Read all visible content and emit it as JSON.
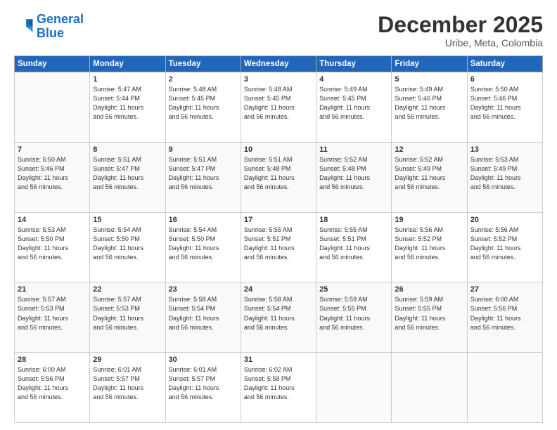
{
  "logo": {
    "line1": "General",
    "line2": "Blue"
  },
  "title": "December 2025",
  "subtitle": "Uribe, Meta, Colombia",
  "header_days": [
    "Sunday",
    "Monday",
    "Tuesday",
    "Wednesday",
    "Thursday",
    "Friday",
    "Saturday"
  ],
  "weeks": [
    [
      {
        "num": "",
        "info": ""
      },
      {
        "num": "1",
        "info": "Sunrise: 5:47 AM\nSunset: 5:44 PM\nDaylight: 11 hours\nand 56 minutes."
      },
      {
        "num": "2",
        "info": "Sunrise: 5:48 AM\nSunset: 5:45 PM\nDaylight: 11 hours\nand 56 minutes."
      },
      {
        "num": "3",
        "info": "Sunrise: 5:48 AM\nSunset: 5:45 PM\nDaylight: 11 hours\nand 56 minutes."
      },
      {
        "num": "4",
        "info": "Sunrise: 5:49 AM\nSunset: 5:45 PM\nDaylight: 11 hours\nand 56 minutes."
      },
      {
        "num": "5",
        "info": "Sunrise: 5:49 AM\nSunset: 5:46 PM\nDaylight: 11 hours\nand 56 minutes."
      },
      {
        "num": "6",
        "info": "Sunrise: 5:50 AM\nSunset: 5:46 PM\nDaylight: 11 hours\nand 56 minutes."
      }
    ],
    [
      {
        "num": "7",
        "info": "Sunrise: 5:50 AM\nSunset: 5:46 PM\nDaylight: 11 hours\nand 56 minutes."
      },
      {
        "num": "8",
        "info": "Sunrise: 5:51 AM\nSunset: 5:47 PM\nDaylight: 11 hours\nand 56 minutes."
      },
      {
        "num": "9",
        "info": "Sunrise: 5:51 AM\nSunset: 5:47 PM\nDaylight: 11 hours\nand 56 minutes."
      },
      {
        "num": "10",
        "info": "Sunrise: 5:51 AM\nSunset: 5:48 PM\nDaylight: 11 hours\nand 56 minutes."
      },
      {
        "num": "11",
        "info": "Sunrise: 5:52 AM\nSunset: 5:48 PM\nDaylight: 11 hours\nand 56 minutes."
      },
      {
        "num": "12",
        "info": "Sunrise: 5:52 AM\nSunset: 5:49 PM\nDaylight: 11 hours\nand 56 minutes."
      },
      {
        "num": "13",
        "info": "Sunrise: 5:53 AM\nSunset: 5:49 PM\nDaylight: 11 hours\nand 56 minutes."
      }
    ],
    [
      {
        "num": "14",
        "info": "Sunrise: 5:53 AM\nSunset: 5:50 PM\nDaylight: 11 hours\nand 56 minutes."
      },
      {
        "num": "15",
        "info": "Sunrise: 5:54 AM\nSunset: 5:50 PM\nDaylight: 11 hours\nand 56 minutes."
      },
      {
        "num": "16",
        "info": "Sunrise: 5:54 AM\nSunset: 5:50 PM\nDaylight: 11 hours\nand 56 minutes."
      },
      {
        "num": "17",
        "info": "Sunrise: 5:55 AM\nSunset: 5:51 PM\nDaylight: 11 hours\nand 56 minutes."
      },
      {
        "num": "18",
        "info": "Sunrise: 5:55 AM\nSunset: 5:51 PM\nDaylight: 11 hours\nand 56 minutes."
      },
      {
        "num": "19",
        "info": "Sunrise: 5:56 AM\nSunset: 5:52 PM\nDaylight: 11 hours\nand 56 minutes."
      },
      {
        "num": "20",
        "info": "Sunrise: 5:56 AM\nSunset: 5:52 PM\nDaylight: 11 hours\nand 56 minutes."
      }
    ],
    [
      {
        "num": "21",
        "info": "Sunrise: 5:57 AM\nSunset: 5:53 PM\nDaylight: 11 hours\nand 56 minutes."
      },
      {
        "num": "22",
        "info": "Sunrise: 5:57 AM\nSunset: 5:53 PM\nDaylight: 11 hours\nand 56 minutes."
      },
      {
        "num": "23",
        "info": "Sunrise: 5:58 AM\nSunset: 5:54 PM\nDaylight: 11 hours\nand 56 minutes."
      },
      {
        "num": "24",
        "info": "Sunrise: 5:58 AM\nSunset: 5:54 PM\nDaylight: 11 hours\nand 56 minutes."
      },
      {
        "num": "25",
        "info": "Sunrise: 5:59 AM\nSunset: 5:55 PM\nDaylight: 11 hours\nand 56 minutes."
      },
      {
        "num": "26",
        "info": "Sunrise: 5:59 AM\nSunset: 5:55 PM\nDaylight: 11 hours\nand 56 minutes."
      },
      {
        "num": "27",
        "info": "Sunrise: 6:00 AM\nSunset: 5:56 PM\nDaylight: 11 hours\nand 56 minutes."
      }
    ],
    [
      {
        "num": "28",
        "info": "Sunrise: 6:00 AM\nSunset: 5:56 PM\nDaylight: 11 hours\nand 56 minutes."
      },
      {
        "num": "29",
        "info": "Sunrise: 6:01 AM\nSunset: 5:57 PM\nDaylight: 11 hours\nand 56 minutes."
      },
      {
        "num": "30",
        "info": "Sunrise: 6:01 AM\nSunset: 5:57 PM\nDaylight: 11 hours\nand 56 minutes."
      },
      {
        "num": "31",
        "info": "Sunrise: 6:02 AM\nSunset: 5:58 PM\nDaylight: 11 hours\nand 56 minutes."
      },
      {
        "num": "",
        "info": ""
      },
      {
        "num": "",
        "info": ""
      },
      {
        "num": "",
        "info": ""
      }
    ]
  ]
}
